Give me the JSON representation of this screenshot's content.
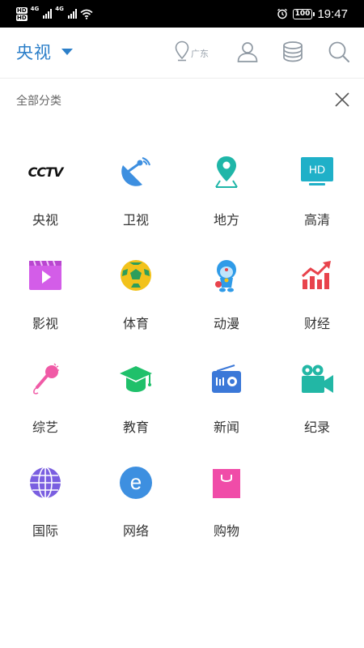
{
  "status_bar": {
    "hd_badge": "HD",
    "network_1": "4G",
    "network_2": "4G",
    "battery": "100",
    "time": "19:47"
  },
  "header": {
    "channel": "央视",
    "location": "广东"
  },
  "section": {
    "title": "全部分类"
  },
  "categories": [
    {
      "label": "央视",
      "icon": "cctv-logo-icon",
      "logo_text": "CCTV"
    },
    {
      "label": "卫视",
      "icon": "satellite-dish-icon",
      "color": "#3d8fe0"
    },
    {
      "label": "地方",
      "icon": "map-pin-icon",
      "color": "#1fb6a8"
    },
    {
      "label": "高清",
      "icon": "hd-tv-icon",
      "color": "#1fb0c8",
      "icon_text": "HD"
    },
    {
      "label": "影视",
      "icon": "video-play-icon",
      "color": "#d35de8"
    },
    {
      "label": "体育",
      "icon": "soccer-ball-icon",
      "color": "#f2c21b"
    },
    {
      "label": "动漫",
      "icon": "cartoon-robot-icon",
      "color": "#2f9be8"
    },
    {
      "label": "财经",
      "icon": "finance-chart-icon",
      "color": "#e8434c"
    },
    {
      "label": "综艺",
      "icon": "microphone-icon",
      "color": "#f05aa6"
    },
    {
      "label": "教育",
      "icon": "graduation-cap-icon",
      "color": "#1fc06a"
    },
    {
      "label": "新闻",
      "icon": "radio-icon",
      "color": "#3b78d8"
    },
    {
      "label": "纪录",
      "icon": "movie-camera-icon",
      "color": "#22b7a5"
    },
    {
      "label": "国际",
      "icon": "globe-icon",
      "color": "#7a5ee0"
    },
    {
      "label": "网络",
      "icon": "letter-e-icon",
      "color": "#3d8fe0",
      "icon_text": "e"
    },
    {
      "label": "购物",
      "icon": "shopping-bag-icon",
      "color": "#f04ca8"
    }
  ]
}
